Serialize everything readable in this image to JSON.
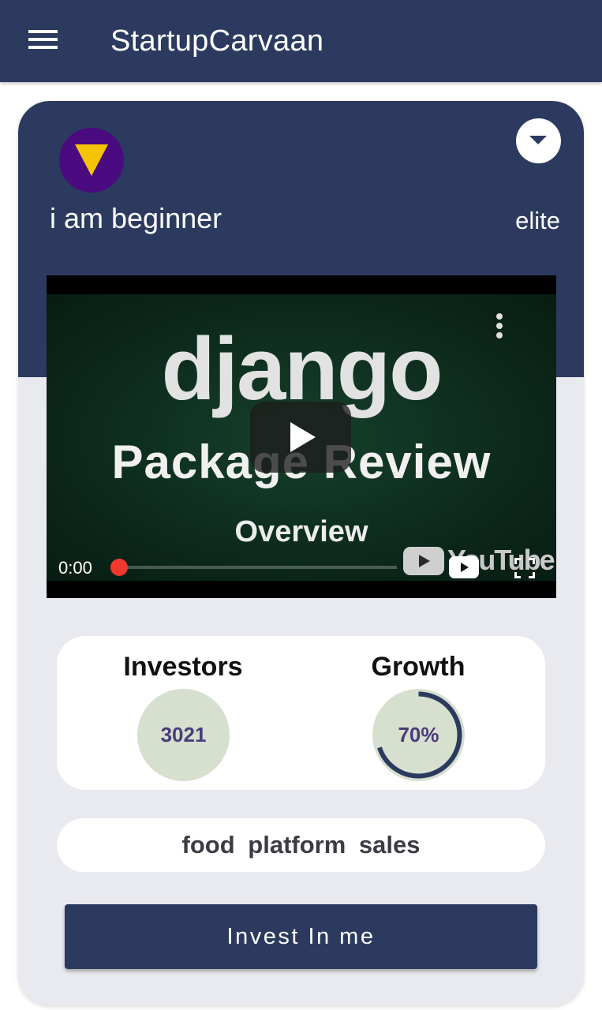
{
  "app": {
    "title": "StartupCarvaan"
  },
  "profile": {
    "name": "i am beginner",
    "tier": "elite"
  },
  "video": {
    "title_line1": "django",
    "title_line2": "Package Review",
    "title_line3": "Overview",
    "time": "0:00",
    "progress": 0,
    "brand": "YouTube"
  },
  "stats": {
    "investors": {
      "label": "Investors",
      "value": "3021"
    },
    "growth": {
      "label": "Growth",
      "value": "70%",
      "percent": 70
    }
  },
  "tags": {
    "text": "food  platform  sales"
  },
  "actions": {
    "invest_label": "Invest In me"
  },
  "colors": {
    "primary": "#2b3a5e",
    "card_background": "#e9eaef",
    "avatar": "#4a0a80",
    "avatar_triangle": "#f5c400",
    "stat_circle": "#d7dfcf",
    "stat_value": "#4a3d7a",
    "progress_scrub": "#f0382e"
  }
}
